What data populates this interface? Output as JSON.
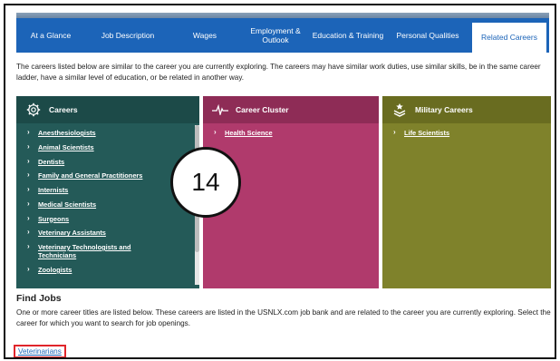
{
  "tabs": [
    {
      "label": "At a Glance"
    },
    {
      "label": "Job Description"
    },
    {
      "label": "Wages"
    },
    {
      "label": "Employment & Outlook"
    },
    {
      "label": "Education & Training"
    },
    {
      "label": "Personal Qualities"
    },
    {
      "label": "Related Careers"
    }
  ],
  "intro": "The careers listed below are similar to the career you are currently exploring. The careers may have similar work duties, use similar skills, be in the same career ladder, have a similar level of education, or be related in another way.",
  "careers_panel": {
    "title": "Careers",
    "items": [
      "Anesthesiologists",
      "Animal Scientists",
      "Dentists",
      "Family and General Practitioners",
      "Internists",
      "Medical Scientists",
      "Surgeons",
      "Veterinary Assistants",
      "Veterinary Technologists and Technicians",
      "Zoologists"
    ]
  },
  "cluster_panel": {
    "title": "Career Cluster",
    "items": [
      "Health Science"
    ]
  },
  "military_panel": {
    "title": "Military Careers",
    "items": [
      "Life Scientists"
    ]
  },
  "badge": "14",
  "find_jobs": {
    "title": "Find Jobs",
    "description": "One or more career titles are listed below. These careers are listed in the USNLX.com job bank and are related to the career you are currently exploring. Select the career for which you want to search for job openings.",
    "link": "Veterinarians"
  },
  "colors": {
    "tab_blue": "#1c64b8",
    "careers_teal": "#245a58",
    "cluster_magenta": "#b03a6c",
    "military_olive": "#7f822b",
    "highlight_red": "#e0252b"
  }
}
